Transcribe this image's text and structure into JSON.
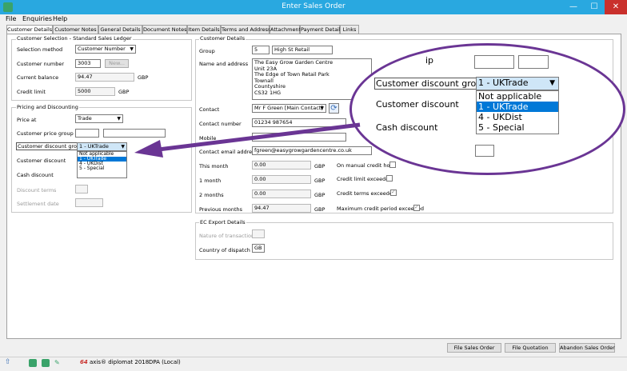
{
  "window": {
    "title": "Enter Sales Order",
    "minimize": "—",
    "maximize": "☐",
    "close": "✕"
  },
  "menu": [
    "File",
    "Enquiries",
    "Help"
  ],
  "tabs": [
    "Customer Details",
    "Customer Notes",
    "General Details",
    "Document Notes",
    "Item Details",
    "Terms and Addresses",
    "Attachments",
    "Payment Details",
    "Links"
  ],
  "customer_selection": {
    "title": "Customer Selection - Standard Sales Ledger",
    "selection_method_label": "Selection method",
    "selection_method_value": "Customer Number",
    "customer_number_label": "Customer number",
    "customer_number_value": "3003",
    "new_button": "New...",
    "current_balance_label": "Current balance",
    "current_balance_value": "94.47",
    "credit_limit_label": "Credit limit",
    "credit_limit_value": "5000",
    "currency": "GBP"
  },
  "pricing": {
    "title": "Pricing and Discounting",
    "price_at_label": "Price at",
    "price_at_value": "Trade",
    "customer_price_group_label": "Customer price group",
    "customer_discount_group_label": "Customer discount group",
    "customer_discount_group_value": "1 - UKTrade",
    "customer_discount_label": "Customer discount",
    "cash_discount_label": "Cash discount",
    "discount_terms_label": "Discount terms",
    "settlement_date_label": "Settlement date",
    "discount_group_options": [
      "Not applicable",
      "1 - UKTrade",
      "4 - UKDist",
      "5 - Special"
    ]
  },
  "customer_details": {
    "title": "Customer Details",
    "group_label": "Group",
    "group_code": "5",
    "group_name": "High St Retail",
    "name_address_label": "Name and address",
    "address_lines": [
      "The Easy Grow Garden Centre",
      "Unit 23A",
      "The Edge of Town Retail Park",
      "Townall",
      "Countyshire",
      "CS32 1HG"
    ],
    "contact_label": "Contact",
    "contact_value": "Mr F Green [Main Contact]",
    "contact_number_label": "Contact number",
    "contact_number_value": "01234 987654",
    "mobile_label": "Mobile",
    "email_label": "Contact email address",
    "email_value": "fgreen@easygrowgardencentre.co.uk",
    "this_month_label": "This month",
    "this_month_value": "0.00",
    "one_month_label": "1 month",
    "one_month_value": "0.00",
    "two_months_label": "2 months",
    "two_months_value": "0.00",
    "previous_months_label": "Previous months",
    "previous_months_value": "94.47",
    "on_hold_label": "On manual credit hold",
    "credit_limit_exceeded_label": "Credit limit exceeded",
    "credit_terms_exceeded_label": "Credit terms exceeded",
    "max_credit_period_label": "Maximum credit period exceeded"
  },
  "ec_export": {
    "title": "EC Export Details",
    "nature_label": "Nature of transaction",
    "country_label": "Country of dispatch",
    "country_value": "GB"
  },
  "zoom": {
    "partial_label": "ip",
    "discount_group_label": "Customer discount group",
    "discount_group_value": "1 - UKTrade",
    "customer_discount_label": "Customer discount",
    "cash_discount_label": "Cash discount"
  },
  "buttons": {
    "file": "File Sales Order",
    "quotation": "File Quotation",
    "abandon": "Abandon Sales Order"
  },
  "status": {
    "app": "axis® diplomat 2018",
    "dpa": "DPA (Local)",
    "logo": "64"
  },
  "colors": {
    "titlebar": "#29a8e0",
    "highlight": "#0078d7",
    "annotation": "#6a3594"
  }
}
